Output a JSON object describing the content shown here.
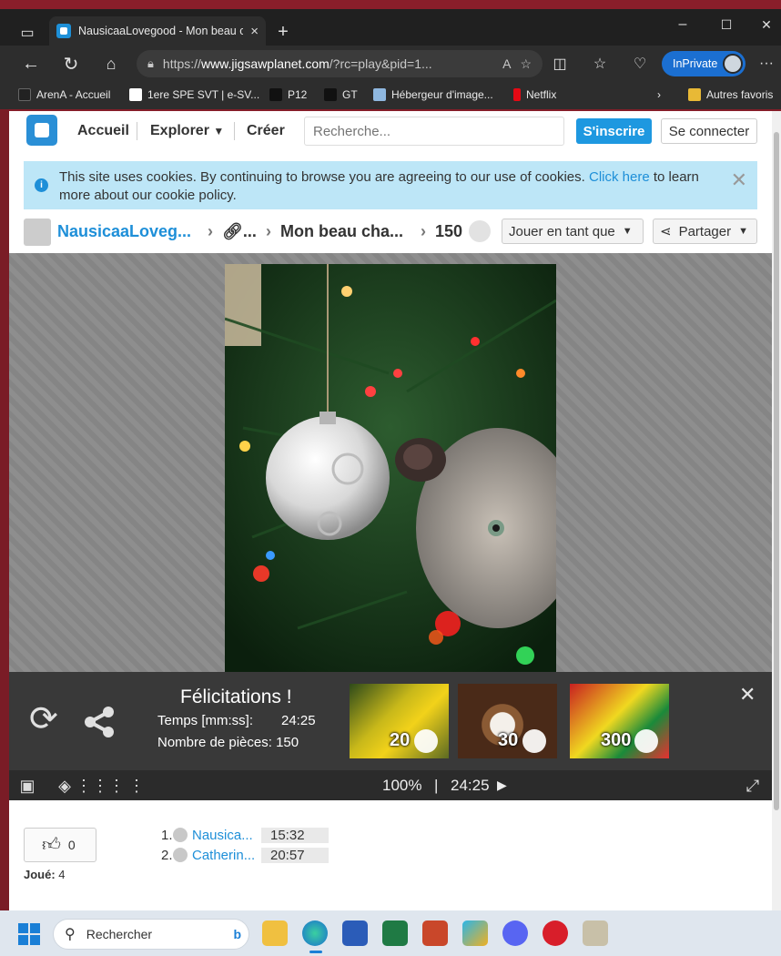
{
  "browser": {
    "tab_title": "NausicaaLovegood - Mon beau c",
    "tab_close": "×",
    "new_tab": "+",
    "url_prefix": "https://",
    "url_host": "www.jigsawplanet.com",
    "url_rest": "/?rc=play&pid=1...",
    "inprivate_label": "InPrivate",
    "window_controls": [
      "–",
      "☐",
      "✕"
    ],
    "more": "···"
  },
  "bookmarks": [
    {
      "label": "ArenA - Accueil",
      "color": "#222222"
    },
    {
      "label": "1ere SPE SVT | e-SV...",
      "color": "#ffffff"
    },
    {
      "label": "P12",
      "color": "#111111"
    },
    {
      "label": "GT",
      "color": "#111111"
    },
    {
      "label": "Hébergeur d'image...",
      "color": "#8fb8e0"
    },
    {
      "label": "Netflix",
      "color": "#e50914"
    }
  ],
  "other_favorites": "Autres favoris",
  "site": {
    "nav": [
      "Accueil",
      "Explorer",
      "Créer"
    ],
    "search_placeholder": "Recherche...",
    "signup": "S'inscrire",
    "login": "Se connecter",
    "accent": "#1e98e0"
  },
  "cookie": {
    "text_before": "This site uses cookies. By continuing to browse you are agreeing to our use of cookies.",
    "link": "Click here",
    "text_after": "to learn more about our cookie policy."
  },
  "breadcrumb": {
    "user": "NausicaaLoveg...",
    "link_part": "...",
    "title": "Mon beau cha...",
    "pieces": "150",
    "play_as": "Jouer en tant que",
    "share": "Partager"
  },
  "congrats": {
    "title": "Félicitations !",
    "time_label": "Temps [mm:ss]:",
    "time_value": "24:25",
    "pieces_label": "Nombre de pièces: 150",
    "suggestions": [
      {
        "count": "20"
      },
      {
        "count": "30"
      },
      {
        "count": "300"
      }
    ]
  },
  "toolbar": {
    "zoom": "100%",
    "divider": "|",
    "timer": "24:25"
  },
  "like_count": "0",
  "played_label": "Joué:",
  "played_value": "4",
  "scores": [
    {
      "rank": "1.",
      "name": "Nausica...",
      "time": "15:32"
    },
    {
      "rank": "2.",
      "name": "Catherin...",
      "time": "20:57"
    }
  ],
  "taskbar": {
    "search_label": "Rechercher"
  }
}
